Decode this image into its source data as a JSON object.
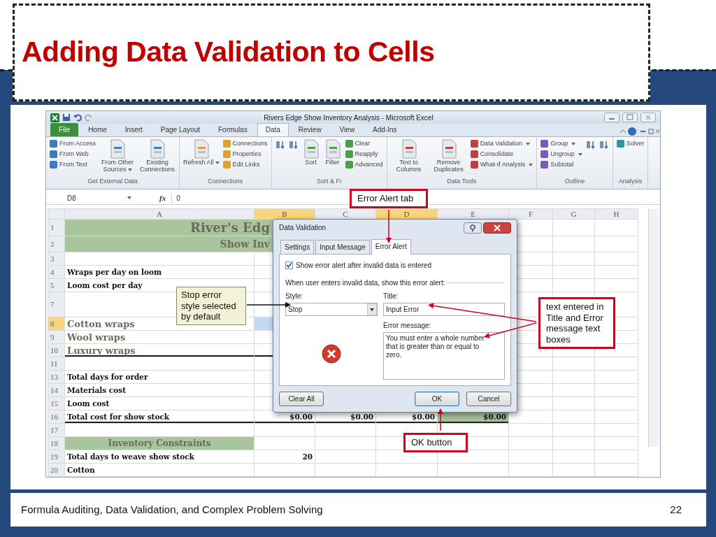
{
  "slide": {
    "title": "Adding Data Validation to Cells",
    "footer": "Formula Auditing, Data Validation, and Complex Problem Solving",
    "page_number": "22"
  },
  "excel": {
    "window_title": "Rivers Edge Show Inventory Analysis - Microsoft Excel",
    "ribbon_tabs": [
      {
        "label": "File",
        "selected": false,
        "kind": "file"
      },
      {
        "label": "Home",
        "selected": false,
        "kind": "tab"
      },
      {
        "label": "Insert",
        "selected": false,
        "kind": "tab"
      },
      {
        "label": "Page Layout",
        "selected": false,
        "kind": "tab"
      },
      {
        "label": "Formulas",
        "selected": false,
        "kind": "tab"
      },
      {
        "label": "Data",
        "selected": true,
        "kind": "tab"
      },
      {
        "label": "Review",
        "selected": false,
        "kind": "tab"
      },
      {
        "label": "View",
        "selected": false,
        "kind": "tab"
      },
      {
        "label": "Add-Ins",
        "selected": false,
        "kind": "tab"
      }
    ],
    "ribbon_groups": [
      {
        "label": "Get External Data",
        "items": [
          {
            "kind": "small",
            "label": "From Access",
            "dropdown": false
          },
          {
            "kind": "small",
            "label": "From Web",
            "dropdown": false
          },
          {
            "kind": "small",
            "label": "From Text",
            "dropdown": false
          },
          {
            "kind": "large",
            "label": "From Other Sources",
            "dropdown": true
          },
          {
            "kind": "large",
            "label": "Existing Connections",
            "dropdown": false
          }
        ]
      },
      {
        "label": "Connections",
        "items": [
          {
            "kind": "large",
            "label": "Refresh All",
            "dropdown": true
          },
          {
            "kind": "small",
            "label": "Connections",
            "dropdown": false
          },
          {
            "kind": "small",
            "label": "Properties",
            "dropdown": false
          },
          {
            "kind": "small",
            "label": "Edit Links",
            "dropdown": false
          }
        ]
      },
      {
        "label": "Sort & Fi",
        "items": [
          {
            "kind": "icon"
          },
          {
            "kind": "icon"
          },
          {
            "kind": "large",
            "label": "Sort",
            "dropdown": false
          },
          {
            "kind": "large",
            "label": "Filter",
            "dropdown": false
          },
          {
            "kind": "small",
            "label": "Clear",
            "dropdown": false
          },
          {
            "kind": "small",
            "label": "Reapply",
            "dropdown": false
          },
          {
            "kind": "small",
            "label": "Advanced",
            "dropdown": false
          }
        ]
      },
      {
        "label": "Data Tools",
        "items": [
          {
            "kind": "large",
            "label": "Text to Columns",
            "dropdown": false
          },
          {
            "kind": "large",
            "label": "Remove Duplicates",
            "dropdown": false
          },
          {
            "kind": "small",
            "label": "Data Validation",
            "dropdown": true
          },
          {
            "kind": "small",
            "label": "Consolidate",
            "dropdown": false
          },
          {
            "kind": "small",
            "label": "What-If Analysis",
            "dropdown": true
          }
        ]
      },
      {
        "label": "Outline",
        "items": [
          {
            "kind": "small",
            "label": "Group",
            "dropdown": true
          },
          {
            "kind": "small",
            "label": "Ungroup",
            "dropdown": true
          },
          {
            "kind": "small",
            "label": "Subtotal",
            "dropdown": false
          },
          {
            "kind": "icon"
          },
          {
            "kind": "icon"
          }
        ]
      },
      {
        "label": "Analysis",
        "items": [
          {
            "kind": "small",
            "label": "Solver",
            "dropdown": false
          }
        ]
      }
    ],
    "name_box": "D8",
    "formula_label": "fx",
    "formula": "0",
    "columns": [
      {
        "label": "A",
        "selected": false
      },
      {
        "label": "B",
        "selected": true
      },
      {
        "label": "C",
        "selected": false
      },
      {
        "label": "D",
        "selected": true
      },
      {
        "label": "E",
        "selected": false
      },
      {
        "label": "F",
        "selected": false
      },
      {
        "label": "G",
        "selected": false
      },
      {
        "label": "H",
        "selected": false
      }
    ],
    "rows": [
      {
        "number": "1",
        "selected": false,
        "kind": "title",
        "rule_below": false,
        "cells": {
          "A": {
            "text": "River's Edg"
          }
        }
      },
      {
        "number": "2",
        "selected": false,
        "kind": "subtitle",
        "rule_below": false,
        "cells": {
          "A": {
            "text": "Show Inv"
          }
        }
      },
      {
        "number": "3",
        "selected": false,
        "kind": "label",
        "rule_below": false,
        "cells": {}
      },
      {
        "number": "4",
        "selected": false,
        "kind": "label",
        "rule_below": false,
        "cells": {
          "A": {
            "text": "Wraps per day on loom"
          }
        }
      },
      {
        "number": "5",
        "selected": false,
        "kind": "label",
        "rule_below": false,
        "cells": {
          "A": {
            "text": "Loom cost per day"
          }
        }
      },
      {
        "number": "7",
        "selected": false,
        "kind": "tall",
        "rule_below": false,
        "cells": {}
      },
      {
        "number": "8",
        "selected": true,
        "kind": "item",
        "rule_below": false,
        "cells": {
          "A": {
            "text": "Cotton wraps"
          },
          "B": {
            "selected": true
          }
        }
      },
      {
        "number": "9",
        "selected": false,
        "kind": "item",
        "rule_below": false,
        "cells": {
          "A": {
            "text": "Wool wraps"
          }
        }
      },
      {
        "number": "10",
        "selected": false,
        "kind": "item",
        "rule_below": true,
        "cells": {
          "A": {
            "text": "Luxury wraps"
          }
        }
      },
      {
        "number": "11",
        "selected": false,
        "kind": "label",
        "rule_below": false,
        "cells": {}
      },
      {
        "number": "13",
        "selected": false,
        "kind": "label",
        "rule_below": false,
        "cells": {
          "A": {
            "text": "Total days for order"
          }
        }
      },
      {
        "number": "14",
        "selected": false,
        "kind": "label",
        "rule_below": false,
        "cells": {
          "A": {
            "text": "Materials cost"
          }
        }
      },
      {
        "number": "15",
        "selected": false,
        "kind": "label",
        "rule_below": false,
        "cells": {
          "A": {
            "text": "Loom cost"
          }
        }
      },
      {
        "number": "16",
        "selected": false,
        "kind": "label",
        "rule_below": true,
        "cells": {
          "A": {
            "text": "Total cost for show stock"
          },
          "B": {
            "text": "$0.00"
          },
          "C": {
            "text": "$0.00"
          },
          "D": {
            "text": "$0.00"
          },
          "E": {
            "text": "$0.00",
            "shaded": true
          }
        }
      },
      {
        "number": "17",
        "selected": false,
        "kind": "label",
        "rule_below": false,
        "cells": {}
      },
      {
        "number": "18",
        "selected": false,
        "kind": "header",
        "rule_below": false,
        "cells": {
          "A": {
            "text": "Inventory Constraints"
          }
        }
      },
      {
        "number": "19",
        "selected": false,
        "kind": "label",
        "rule_below": false,
        "cells": {
          "A": {
            "text": "Total days to weave show stock"
          },
          "B": {
            "text": "20"
          }
        }
      },
      {
        "number": "20",
        "selected": false,
        "kind": "label",
        "rule_below": false,
        "cells": {
          "A": {
            "text": "Cotton"
          }
        }
      }
    ]
  },
  "dialog": {
    "title": "Data Validation",
    "tabs": [
      {
        "label": "Settings",
        "selected": false
      },
      {
        "label": "Input Message",
        "selected": false
      },
      {
        "label": "Error Alert",
        "selected": true
      }
    ],
    "show_alert": {
      "label": "Show error alert after invalid data is entered",
      "checked": true
    },
    "intro": "When user enters invalid data, show this error alert:",
    "style_label": "Style:",
    "style_value": "Stop",
    "title_label": "Title:",
    "title_value": "Input Error",
    "message_label": "Error message:",
    "message_value": "You must enter a whole number that is greater than or equal to zero.",
    "buttons": [
      {
        "label": "Clear All",
        "kind": "normal"
      },
      {
        "label": "OK",
        "kind": "default"
      },
      {
        "label": "Cancel",
        "kind": "normal"
      }
    ]
  },
  "callouts": [
    {
      "text": "Error Alert tab",
      "kind": "red"
    },
    {
      "text": "Stop error style selected by default",
      "kind": "note"
    },
    {
      "text": "text entered in Title and Error message text boxes",
      "kind": "red"
    },
    {
      "text": "OK button",
      "kind": "red"
    }
  ]
}
